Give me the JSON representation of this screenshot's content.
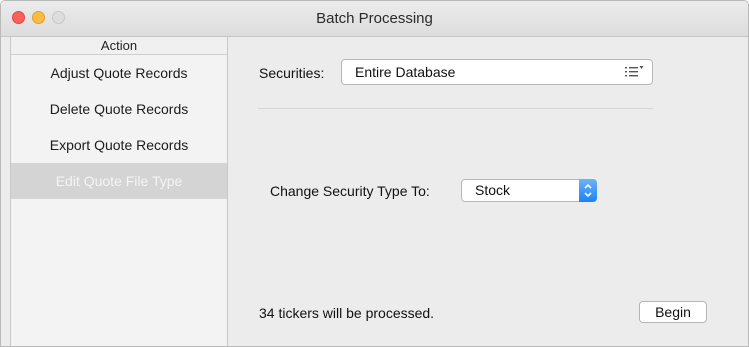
{
  "window": {
    "title": "Batch Processing"
  },
  "sidebar": {
    "header": "Action",
    "items": [
      {
        "label": "Adjust Quote Records"
      },
      {
        "label": "Delete Quote Records"
      },
      {
        "label": "Export Quote Records"
      },
      {
        "label": "Edit Quote File Type",
        "selected": true
      }
    ]
  },
  "main": {
    "securities_label": "Securities:",
    "securities_value": "Entire Database",
    "change_type_label": "Change Security Type To:",
    "change_type_value": "Stock",
    "status_text": "34 tickers will be processed.",
    "begin_label": "Begin"
  },
  "colors": {
    "accent": "#1a82fb",
    "selection": "#d4d4d4",
    "close": "#fc605c",
    "minimize": "#fdbc40"
  }
}
